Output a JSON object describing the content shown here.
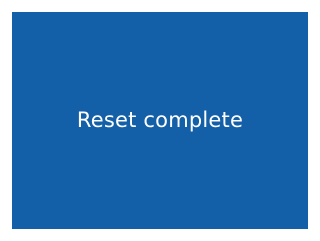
{
  "screen": {
    "message": "Reset complete",
    "background_color": "#135fa8",
    "text_color": "#ffffff"
  }
}
